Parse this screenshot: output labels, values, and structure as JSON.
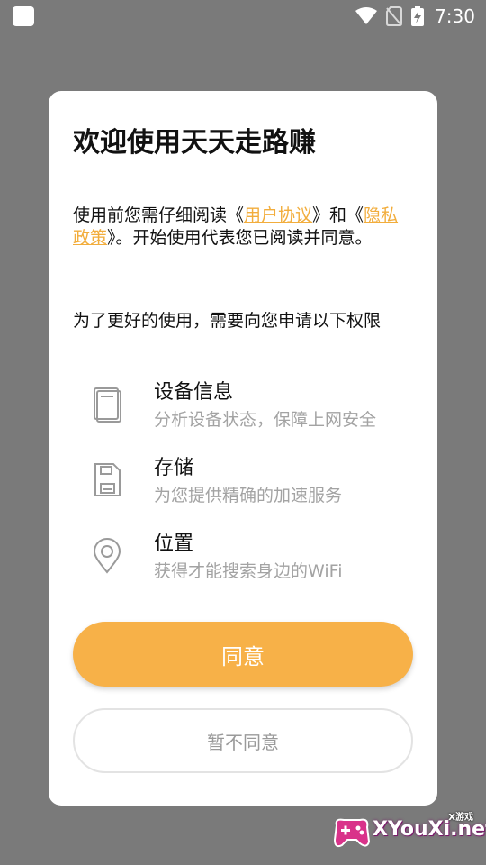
{
  "status_bar": {
    "time": "7:30",
    "icons": [
      "app-notification-icon",
      "wifi-icon",
      "no-sim-icon",
      "battery-charging-icon"
    ]
  },
  "dialog": {
    "title": "欢迎使用天天走路赚",
    "intro": {
      "part1": "使用前您需仔细阅读《",
      "user_agreement_link": "用户协议",
      "part2": "》和《",
      "privacy_policy_link": "隐私政策",
      "part3": "》。开始使用代表您已阅读并同意。"
    },
    "permissions_heading": "为了更好的使用，需要向您申请以下权限",
    "permissions": [
      {
        "icon": "device-icon",
        "name": "设备信息",
        "desc": "分析设备状态，保障上网安全"
      },
      {
        "icon": "storage-icon",
        "name": "存储",
        "desc": "为您提供精确的加速服务"
      },
      {
        "icon": "location-pin-icon",
        "name": "位置",
        "desc": "获得才能搜索身边的WiFi"
      }
    ],
    "agree_label": "同意",
    "disagree_label": "暂不同意"
  },
  "watermark": {
    "text": "XYouXi.net",
    "small_text": "X游戏"
  },
  "colors": {
    "accent": "#f7b148",
    "link": "#f2ad3c",
    "overlay": "#7a7a7a"
  }
}
